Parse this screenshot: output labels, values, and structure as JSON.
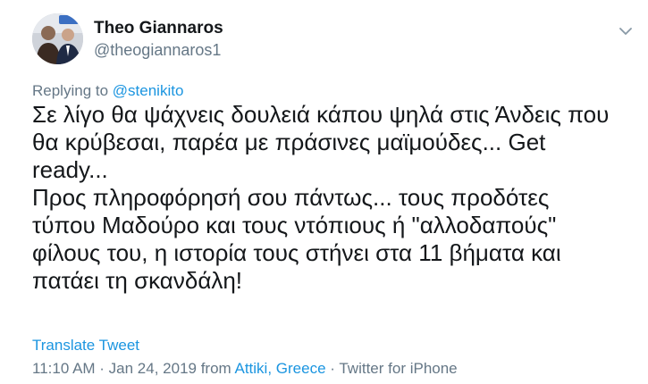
{
  "author": {
    "name": "Theo Giannaros",
    "handle": "@theogiannaros1"
  },
  "reply": {
    "prefix": "Replying to ",
    "mention": "@stenikito"
  },
  "tweet": {
    "lines": [
      "Σε λίγο θα ψάχνεις δουλειά κάπου ψηλά στις Άνδεις που",
      "θα κρύβεσαι, παρέα με πράσινες μαϊμούδες... Get",
      "ready...",
      "Προς πληροφόρησή σου πάντως... τους προδότες",
      "τύπου Μαδούρο και τους ντόπιους ή \"αλλοδαπούς\"",
      "φίλους του, η ιστορία τους στήνει στα 11 βήματα και",
      "πατάει τη σκανδάλη!"
    ]
  },
  "actions": {
    "translate": "Translate Tweet"
  },
  "meta": {
    "time_date": "11:10 AM · Jan 24, 2019 from ",
    "location": "Attiki, Greece",
    "sep": " · ",
    "source": "Twitter for iPhone"
  },
  "colors": {
    "text": "#14171a",
    "secondary": "#657786",
    "link": "#1b95e0"
  },
  "icons": {
    "caret": "chevron-down-icon"
  }
}
